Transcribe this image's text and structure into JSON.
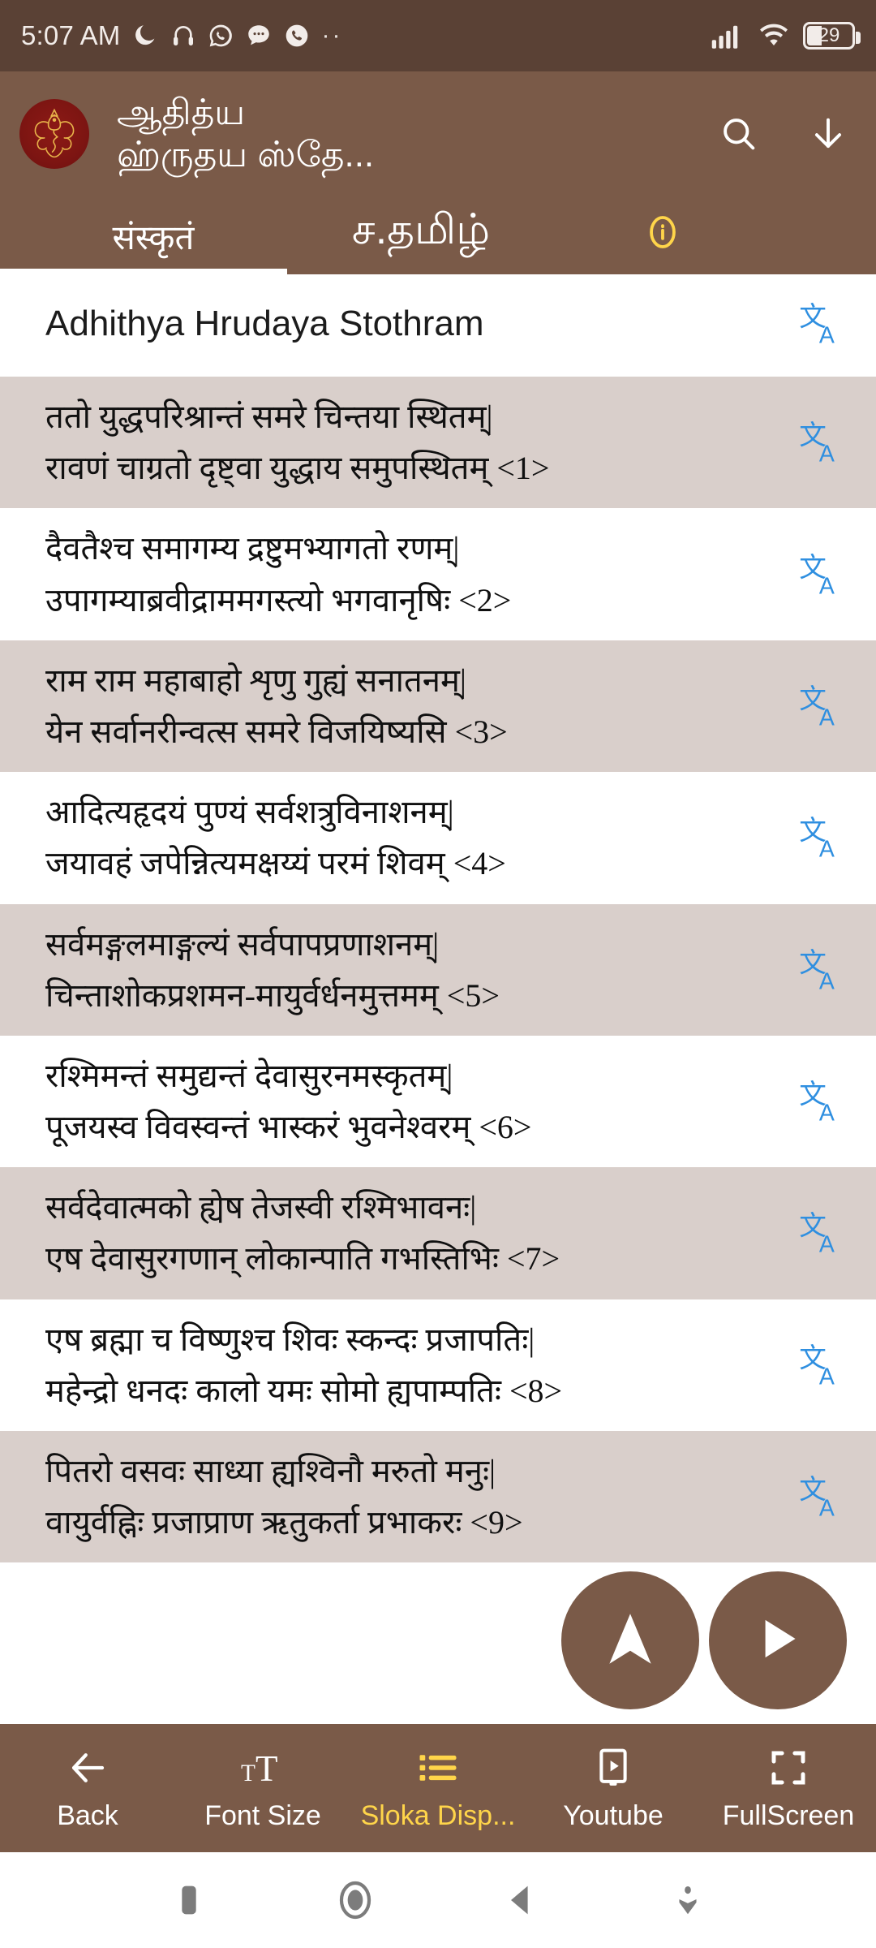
{
  "status_bar": {
    "time": "5:07 AM",
    "left_icons": [
      "moon-icon",
      "headphones-icon",
      "whatsapp-icon",
      "messages-icon",
      "phone-icon",
      "overflow-dots-icon"
    ],
    "overflow_dots": "··",
    "signal_icon": "cellular-signal-icon",
    "wifi_icon": "wifi-icon",
    "battery_level": "29"
  },
  "appbar": {
    "logo": "ganesha-logo-icon",
    "title_line1": "ஆதித்ய",
    "title_line2": "ஹ்ருதய ஸ்தே...",
    "search_icon": "search-icon",
    "download_icon": "download-icon"
  },
  "tabs": {
    "items": [
      {
        "label": "संस्कृतं",
        "active": true
      },
      {
        "label": "ச.தமிழ்",
        "active": false
      }
    ],
    "info_icon": "info-icon",
    "info_color": "#ffd54a"
  },
  "document": {
    "title": "Adhithya Hrudaya Stothram",
    "translate_icon": "translate-icon",
    "translate_color": "#2f8fe0",
    "verses": [
      {
        "text": "ततो युद्धपरिश्रान्तं समरे चिन्तया स्थितम्|\nरावणं चाग्रतो दृष्ट्वा युद्धाय समुपस्थितम् <1>",
        "number": "1",
        "shaded": true
      },
      {
        "text": "दैवतैश्च समागम्य द्रष्टुमभ्यागतो रणम्|\nउपागम्याब्रवीद्राममगस्त्यो भगवानृषिः <2>",
        "number": "2",
        "shaded": false
      },
      {
        "text": "राम राम महाबाहो शृणु गुह्यं सनातनम्|\nयेन सर्वानरीन्वत्स समरे विजयिष्यसि <3>",
        "number": "3",
        "shaded": true
      },
      {
        "text": "आदित्यहृदयं पुण्यं सर्वशत्रुविनाशनम्|\nजयावहं जपेन्नित्यमक्षय्यं परमं शिवम् <4>",
        "number": "4",
        "shaded": false
      },
      {
        "text": "सर्वमङ्गलमाङ्गल्यं सर्वपापप्रणाशनम्|\nचिन्ताशोकप्रशमन-मायुर्वर्धनमुत्तमम् <5>",
        "number": "5",
        "shaded": true
      },
      {
        "text": "रश्मिमन्तं समुद्यन्तं देवासुरनमस्कृतम्|\nपूजयस्व विवस्वन्तं भास्करं भुवनेश्वरम् <6>",
        "number": "6",
        "shaded": false
      },
      {
        "text": "सर्वदेवात्मको ह्येष तेजस्वी रश्मिभावनः|\nएष देवासुरगणान् लोकान्पाति गभस्तिभिः <7>",
        "number": "7",
        "shaded": true
      },
      {
        "text": "एष ब्रह्मा च विष्णुश्च शिवः स्कन्दः प्रजापतिः|\nमहेन्द्रो धनदः कालो यमः सोमो ह्यपाम्पतिः <8>",
        "number": "8",
        "shaded": false
      },
      {
        "text": "पितरो वसवः साध्या ह्यश्विनौ मरुतो मनुः|\nवायुर्वह्निः प्रजाप्राण ऋतुकर्ता प्रभाकरः <9>",
        "number": "9",
        "shaded": true
      }
    ]
  },
  "fabs": {
    "scroll_up": "navigation-up-icon",
    "play": "play-icon",
    "color": "#7a5a48"
  },
  "bottom_toolbar": {
    "items": [
      {
        "label": "Back",
        "icon": "arrow-left-icon",
        "active": false
      },
      {
        "label": "Font Size",
        "icon": "font-size-icon",
        "active": false
      },
      {
        "label": "Sloka Disp...",
        "icon": "list-icon",
        "active": true
      },
      {
        "label": "Youtube",
        "icon": "video-player-icon",
        "active": false
      },
      {
        "label": "FullScreen",
        "icon": "fullscreen-icon",
        "active": false
      }
    ],
    "active_color": "#ffd54a"
  },
  "android_nav": {
    "buttons": [
      "recents-icon",
      "home-icon",
      "back-icon",
      "hide-keyboard-icon"
    ]
  }
}
